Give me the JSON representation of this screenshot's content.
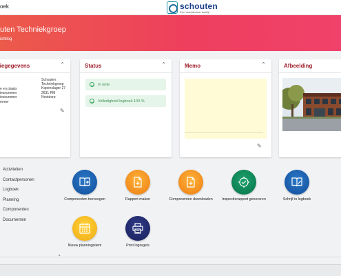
{
  "topbar": {
    "left_text": "oek",
    "logo_name": "schouten",
    "logo_tagline": "Een Vrachtkrimer bedrijf"
  },
  "banner": {
    "title": "uten Techniekgroep",
    "subtitle": "ichtlog"
  },
  "cards": {
    "org": {
      "title": "tiegegevens",
      "labels": [
        "e en plaats",
        "iesnummer",
        "iesnummer",
        "mmer"
      ],
      "values": [
        "Schouten Techniekgroep",
        "Kopenslager 27",
        "2631 RM Nootdorp"
      ]
    },
    "status": {
      "title": "Status",
      "items": [
        "In orde",
        "Volledigheid logboek 100 %"
      ],
      "accent": "#3ba55c"
    },
    "memo": {
      "title": "Memo"
    },
    "image": {
      "title": "Afbeelding"
    }
  },
  "side_menu": [
    "Activiteiten",
    "Contactpersonen",
    "Logboek",
    "Planning",
    "Componenten",
    "Documenten"
  ],
  "actions": [
    {
      "label": "Componenten toevoegen",
      "icon": "book-add-icon",
      "color": "#1a5ba8"
    },
    {
      "label": "Rapport maken",
      "icon": "document-add-icon",
      "color": "#f18a1c"
    },
    {
      "label": "Componenten downloaden",
      "icon": "document-download-icon",
      "color": "#f18a1c"
    },
    {
      "label": "Inspectierapport genereren",
      "icon": "inspection-icon",
      "color": "#0d7f52"
    },
    {
      "label": "Schrijf in logboek",
      "icon": "book-write-icon",
      "color": "#1a5ba8"
    },
    {
      "label": "Nieuw planningsitem",
      "icon": "calendar-icon",
      "color": "#f4b51e"
    },
    {
      "label": "Print logregels",
      "icon": "printer-icon",
      "color": "#1f2766"
    }
  ],
  "colors": {
    "accent_title": "#a0222e",
    "banner_start": "#ec5a4a",
    "banner_end": "#f0426a"
  }
}
